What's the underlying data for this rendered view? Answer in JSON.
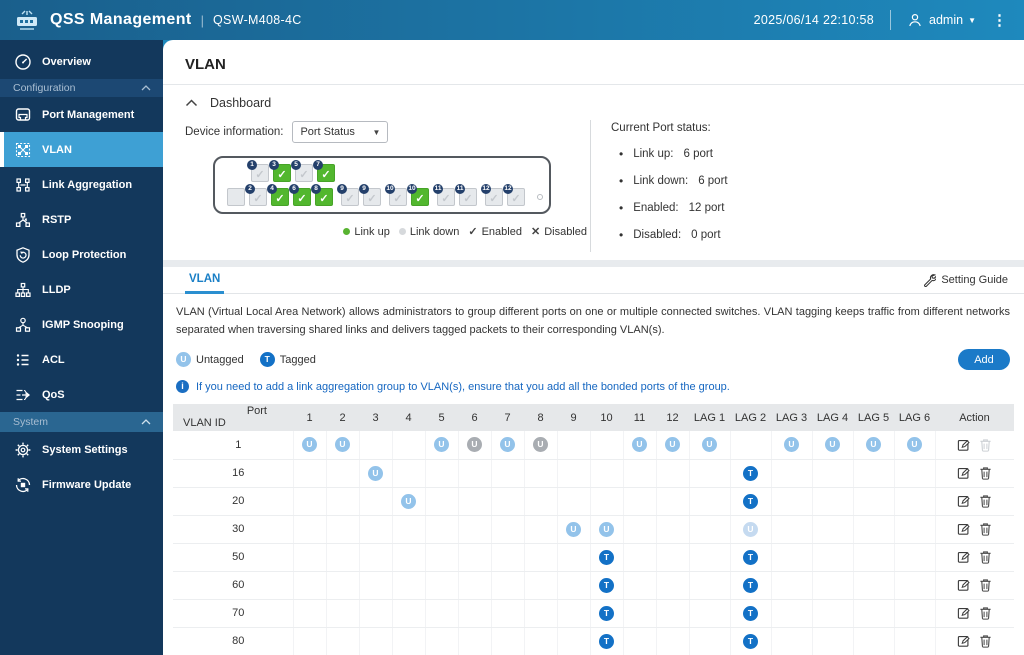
{
  "header": {
    "app_title": "QSS Management",
    "device_model": "QSW-M408-4C",
    "datetime": "2025/06/14 22:10:58",
    "user": "admin"
  },
  "sidebar": {
    "items": [
      {
        "label": "Overview",
        "type": "item"
      },
      {
        "label": "Configuration",
        "type": "section"
      },
      {
        "label": "Port Management",
        "type": "item"
      },
      {
        "label": "VLAN",
        "type": "item",
        "active": true
      },
      {
        "label": "Link Aggregation",
        "type": "item"
      },
      {
        "label": "RSTP",
        "type": "item"
      },
      {
        "label": "Loop Protection",
        "type": "item"
      },
      {
        "label": "LLDP",
        "type": "item"
      },
      {
        "label": "IGMP Snooping",
        "type": "item"
      },
      {
        "label": "ACL",
        "type": "item"
      },
      {
        "label": "QoS",
        "type": "item"
      },
      {
        "label": "System",
        "type": "section"
      },
      {
        "label": "System Settings",
        "type": "item"
      },
      {
        "label": "Firmware Update",
        "type": "item"
      }
    ]
  },
  "page": {
    "title": "VLAN"
  },
  "dashboard": {
    "title": "Dashboard",
    "device_information_label": "Device information:",
    "device_information_value": "Port Status",
    "switch_ports": {
      "top": [
        {
          "num": "1",
          "link": "down"
        },
        {
          "num": "3",
          "link": "up"
        },
        {
          "num": "5",
          "link": "down"
        },
        {
          "num": "7",
          "link": "up"
        }
      ],
      "bottom": [
        {
          "type": "blank"
        },
        {
          "num": "2",
          "link": "down"
        },
        {
          "num": "4",
          "link": "up"
        },
        {
          "num": "6",
          "link": "up"
        },
        {
          "num": "8",
          "link": "up"
        },
        {
          "num": "9",
          "link": "down",
          "group_gap": true
        },
        {
          "num": "9",
          "link": "down"
        },
        {
          "num": "10",
          "link": "down",
          "group_gap": true
        },
        {
          "num": "10",
          "link": "up"
        },
        {
          "num": "11",
          "link": "down",
          "group_gap": true
        },
        {
          "num": "11",
          "link": "down"
        },
        {
          "num": "12",
          "link": "down",
          "group_gap": true
        },
        {
          "num": "12",
          "link": "down"
        }
      ]
    },
    "legend": [
      {
        "label": "Link up",
        "type": "dot",
        "color": "#58b331"
      },
      {
        "label": "Link down",
        "type": "dot",
        "color": "#d6d9dc"
      },
      {
        "label": "Enabled",
        "type": "glyph",
        "glyph": "✓"
      },
      {
        "label": "Disabled",
        "type": "glyph",
        "glyph": "✕"
      }
    ],
    "status": {
      "title": "Current Port status:",
      "items": [
        {
          "label": "Link up:",
          "value": "6 port"
        },
        {
          "label": "Link down:",
          "value": "6 port"
        },
        {
          "label": "Enabled:",
          "value": "12 port"
        },
        {
          "label": "Disabled:",
          "value": "0 port"
        }
      ]
    }
  },
  "vlan_panel": {
    "tab": "VLAN",
    "setting_guide": "Setting Guide",
    "description": "VLAN (Virtual Local Area Network) allows administrators to group different ports on one or multiple connected switches. VLAN tagging keeps traffic from different networks separated when traversing shared links and delivers tagged packets to their corresponding VLAN(s).",
    "untagged_label": "Untagged",
    "tagged_label": "Tagged",
    "add_button": "Add",
    "note": "If you need to add a link aggregation group to VLAN(s), ensure that you add all the bonded ports of the group.",
    "colors": {
      "untagged": "#93c3ea",
      "untagged_inactive": "#a9adb2",
      "untagged_faded": "#c5daf0",
      "tagged": "#1371c6",
      "link_up": "#58b331",
      "accent": "#1b7ac8"
    },
    "table": {
      "corner_top": "Port",
      "corner_bottom": "VLAN ID",
      "columns": [
        "1",
        "2",
        "3",
        "4",
        "5",
        "6",
        "7",
        "8",
        "9",
        "10",
        "11",
        "12",
        "LAG 1",
        "LAG 2",
        "LAG 3",
        "LAG 4",
        "LAG 5",
        "LAG 6"
      ],
      "action_label": "Action",
      "rows": [
        {
          "id": "1",
          "cells": [
            "U",
            "U",
            "",
            "",
            "U",
            "Ug",
            "U",
            "Ug",
            "",
            "",
            "U",
            "U",
            "U",
            "",
            "U",
            "U",
            "U",
            "U"
          ],
          "can_delete": false
        },
        {
          "id": "16",
          "cells": [
            "",
            "",
            "U",
            "",
            "",
            "",
            "",
            "",
            "",
            "",
            "",
            "",
            "",
            "T",
            "",
            "",
            "",
            ""
          ],
          "can_delete": true
        },
        {
          "id": "20",
          "cells": [
            "",
            "",
            "",
            "U",
            "",
            "",
            "",
            "",
            "",
            "",
            "",
            "",
            "",
            "T",
            "",
            "",
            "",
            ""
          ],
          "can_delete": true
        },
        {
          "id": "30",
          "cells": [
            "",
            "",
            "",
            "",
            "",
            "",
            "",
            "",
            "U",
            "U",
            "",
            "",
            "",
            "Uf",
            "",
            "",
            "",
            ""
          ],
          "can_delete": true
        },
        {
          "id": "50",
          "cells": [
            "",
            "",
            "",
            "",
            "",
            "",
            "",
            "",
            "",
            "T",
            "",
            "",
            "",
            "T",
            "",
            "",
            "",
            ""
          ],
          "can_delete": true
        },
        {
          "id": "60",
          "cells": [
            "",
            "",
            "",
            "",
            "",
            "",
            "",
            "",
            "",
            "T",
            "",
            "",
            "",
            "T",
            "",
            "",
            "",
            ""
          ],
          "can_delete": true
        },
        {
          "id": "70",
          "cells": [
            "",
            "",
            "",
            "",
            "",
            "",
            "",
            "",
            "",
            "T",
            "",
            "",
            "",
            "T",
            "",
            "",
            "",
            ""
          ],
          "can_delete": true
        },
        {
          "id": "80",
          "cells": [
            "",
            "",
            "",
            "",
            "",
            "",
            "",
            "",
            "",
            "T",
            "",
            "",
            "",
            "T",
            "",
            "",
            "",
            ""
          ],
          "can_delete": true
        }
      ]
    }
  }
}
